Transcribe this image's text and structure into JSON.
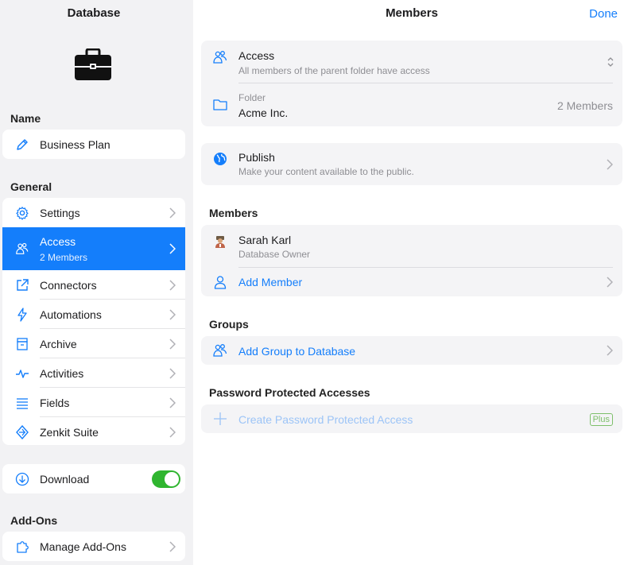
{
  "sidebar": {
    "title": "Database",
    "name_section": "Name",
    "name_value": "Business Plan",
    "general_section": "General",
    "items": [
      {
        "label": "Settings",
        "icon": "gear-icon"
      },
      {
        "label": "Access",
        "sub": "2 Members",
        "icon": "people-icon",
        "active": true
      },
      {
        "label": "Connectors",
        "icon": "external-link-icon"
      },
      {
        "label": "Automations",
        "icon": "lightning-icon"
      },
      {
        "label": "Archive",
        "icon": "archive-box-icon"
      },
      {
        "label": "Activities",
        "icon": "pulse-icon"
      },
      {
        "label": "Fields",
        "icon": "list-icon"
      },
      {
        "label": "Zenkit Suite",
        "icon": "zenkit-icon"
      }
    ],
    "download_label": "Download",
    "download_enabled": true,
    "addons_section": "Add-Ons",
    "manage_addons_label": "Manage Add-Ons"
  },
  "main": {
    "title": "Members",
    "done_label": "Done",
    "access": {
      "title": "Access",
      "sub": "All members of the parent folder have access"
    },
    "folder": {
      "label": "Folder",
      "name": "Acme Inc.",
      "count": "2 Members"
    },
    "publish": {
      "title": "Publish",
      "sub": "Make your content available to the public."
    },
    "members_section": "Members",
    "member": {
      "name": "Sarah Karl",
      "role": "Database Owner"
    },
    "add_member_label": "Add Member",
    "groups_section": "Groups",
    "add_group_label": "Add Group to Database",
    "ppa_section": "Password Protected Accesses",
    "create_ppa_label": "Create Password Protected Access",
    "plus_badge": "Plus"
  },
  "colors": {
    "accent": "#147efb",
    "toggle_on": "#2fb52f",
    "plus": "#7dbf6a"
  }
}
